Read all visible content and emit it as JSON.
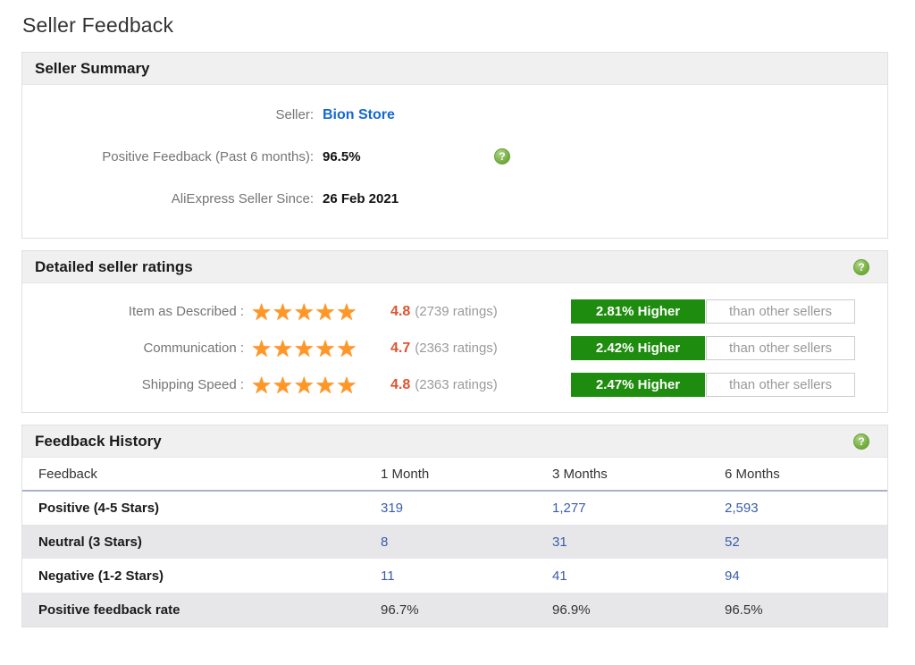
{
  "colors": {
    "accent_green": "#1e8c0e",
    "link_blue": "#1568d4",
    "number_blue": "#3a5dab",
    "rating_orange": "#e0532e",
    "star_orange": "#ff9727",
    "row_alt_bg": "#e7e7ea",
    "header_bar_bg": "#f0f0f0",
    "box_border": "#e0e0e0"
  },
  "icons": {
    "help_glyph": "?",
    "stars_glyphs": "★★★★★"
  },
  "page": {
    "title": "Seller Feedback"
  },
  "summary": {
    "title": "Seller Summary",
    "rows": [
      {
        "label": "Seller:",
        "value": "Bion Store"
      },
      {
        "label": "Positive Feedback (Past 6 months):",
        "value": "96.5%"
      },
      {
        "label": "AliExpress Seller Since:",
        "value": "26 Feb 2021"
      }
    ]
  },
  "ratings": {
    "title": "Detailed seller ratings",
    "rows": [
      {
        "label": "Item as Described :",
        "score": "4.8",
        "count": "(2739 ratings)",
        "fill_percent": 96,
        "badge": "2.81% Higher",
        "compare": "than other sellers"
      },
      {
        "label": "Communication :",
        "score": "4.7",
        "count": "(2363 ratings)",
        "fill_percent": 94,
        "badge": "2.42% Higher",
        "compare": "than other sellers"
      },
      {
        "label": "Shipping Speed :",
        "score": "4.8",
        "count": "(2363 ratings)",
        "fill_percent": 96,
        "badge": "2.47% Higher",
        "compare": "than other sellers"
      }
    ]
  },
  "history": {
    "title": "Feedback History",
    "headers": [
      "Feedback",
      "1 Month",
      "3 Months",
      "6 Months"
    ],
    "rows": [
      {
        "label": "Positive (4-5 Stars)",
        "values": [
          "319",
          "1,277",
          "2,593"
        ]
      },
      {
        "label": "Neutral (3 Stars)",
        "values": [
          "8",
          "31",
          "52"
        ]
      },
      {
        "label": "Negative (1-2 Stars)",
        "values": [
          "11",
          "41",
          "94"
        ]
      },
      {
        "label": "Positive feedback rate",
        "values": [
          "96.7%",
          "96.9%",
          "96.5%"
        ]
      }
    ]
  }
}
